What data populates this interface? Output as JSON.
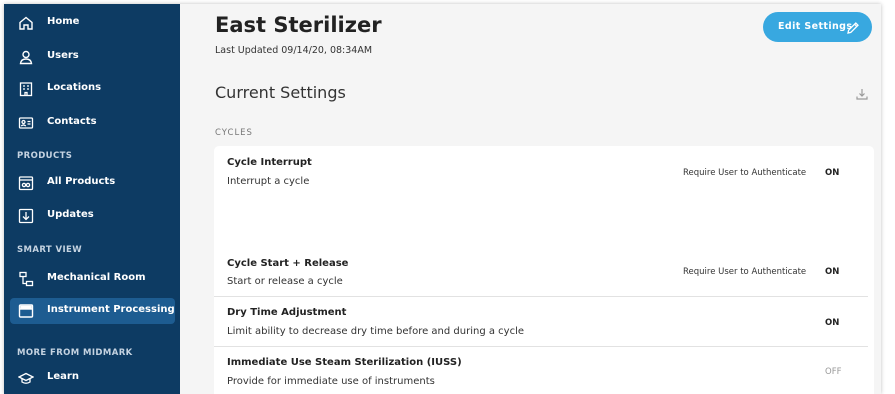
{
  "sidebar": {
    "items": [
      {
        "label": "Home",
        "icon": "home-icon"
      },
      {
        "label": "Users",
        "icon": "user-icon"
      },
      {
        "label": "Locations",
        "icon": "building-icon"
      },
      {
        "label": "Contacts",
        "icon": "contact-card-icon"
      }
    ],
    "products_heading": "PRODUCTS",
    "products": [
      {
        "label": "All Products",
        "icon": "products-icon"
      },
      {
        "label": "Updates",
        "icon": "download-box-icon"
      }
    ],
    "smart_view_heading": "SMART VIEW",
    "smart_view": [
      {
        "label": "Mechanical Room",
        "icon": "network-icon"
      },
      {
        "label": "Instrument Processing",
        "icon": "window-icon"
      }
    ],
    "more_heading": "MORE FROM MIDMARK",
    "more": [
      {
        "label": "Learn",
        "icon": "graduation-cap-icon"
      }
    ]
  },
  "header": {
    "title": "East Sterilizer",
    "last_updated": "Last Updated 09/14/20, 08:34AM",
    "edit_label": "Edit Settings"
  },
  "main": {
    "section_title": "Current Settings",
    "cycles_label": "CYCLES",
    "settings": [
      {
        "title": "Cycle Interrupt",
        "desc": "Interrupt a cycle",
        "requirement": "Require User to Authenticate",
        "status": "ON"
      },
      {
        "title": "Cycle Start + Release",
        "desc": "Start or release a cycle",
        "requirement": "Require User to Authenticate",
        "status": "ON"
      },
      {
        "title": "Dry Time Adjustment",
        "desc": "Limit ability to decrease dry time before and during a cycle",
        "requirement": "",
        "status": "ON"
      },
      {
        "title": "Immediate Use Steam Sterilization (IUSS)",
        "desc": "Provide for immediate use of instruments",
        "requirement": "",
        "status": "OFF"
      }
    ]
  },
  "colors": {
    "sidebar_bg": "#0d3b63",
    "sidebar_active": "#1d5c91",
    "accent": "#38a8e0",
    "page_bg": "#f5f5f5"
  }
}
